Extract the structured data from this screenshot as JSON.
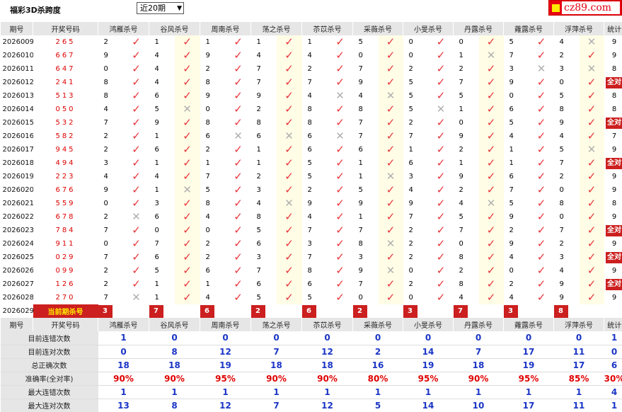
{
  "header": {
    "title": "福彩3D杀跨度",
    "period_select": "近20期",
    "logo_text": "cz89.com"
  },
  "columns": [
    "期号",
    "开奖号码",
    "鸿雁杀号",
    "谷风杀号",
    "周南杀号",
    "荡之杀号",
    "苶苡杀号",
    "采薇杀号",
    "小旻杀号",
    "丹露杀号",
    "蕹露杀号",
    "浮萍杀号",
    "统计"
  ],
  "rows": [
    {
      "period": "2026009",
      "number": "265",
      "kills": [
        [
          "2",
          1
        ],
        [
          "1",
          1
        ],
        [
          "1",
          1
        ],
        [
          "1",
          1
        ],
        [
          "1",
          1
        ],
        [
          "5",
          1
        ],
        [
          "0",
          1
        ],
        [
          "0",
          1
        ],
        [
          "5",
          1
        ],
        [
          "4",
          0
        ]
      ],
      "stat": "9"
    },
    {
      "period": "2026010",
      "number": "667",
      "kills": [
        [
          "9",
          1
        ],
        [
          "4",
          1
        ],
        [
          "9",
          1
        ],
        [
          "4",
          1
        ],
        [
          "4",
          1
        ],
        [
          "0",
          1
        ],
        [
          "0",
          1
        ],
        [
          "1",
          0
        ],
        [
          "7",
          1
        ],
        [
          "2",
          1
        ]
      ],
      "stat": "9"
    },
    {
      "period": "2026011",
      "number": "647",
      "kills": [
        [
          "0",
          1
        ],
        [
          "4",
          1
        ],
        [
          "2",
          1
        ],
        [
          "7",
          1
        ],
        [
          "2",
          1
        ],
        [
          "7",
          1
        ],
        [
          "2",
          1
        ],
        [
          "2",
          1
        ],
        [
          "3",
          0
        ],
        [
          "3",
          0
        ]
      ],
      "stat": "8"
    },
    {
      "period": "2026012",
      "number": "241",
      "kills": [
        [
          "8",
          1
        ],
        [
          "4",
          1
        ],
        [
          "8",
          1
        ],
        [
          "7",
          1
        ],
        [
          "7",
          1
        ],
        [
          "9",
          1
        ],
        [
          "5",
          1
        ],
        [
          "7",
          1
        ],
        [
          "9",
          1
        ],
        [
          "0",
          1
        ]
      ],
      "stat": "全对"
    },
    {
      "period": "2026013",
      "number": "513",
      "kills": [
        [
          "8",
          1
        ],
        [
          "6",
          1
        ],
        [
          "9",
          1
        ],
        [
          "9",
          1
        ],
        [
          "4",
          0
        ],
        [
          "4",
          0
        ],
        [
          "5",
          1
        ],
        [
          "5",
          1
        ],
        [
          "0",
          1
        ],
        [
          "5",
          1
        ]
      ],
      "stat": "8"
    },
    {
      "period": "2026014",
      "number": "050",
      "kills": [
        [
          "4",
          1
        ],
        [
          "5",
          0
        ],
        [
          "0",
          1
        ],
        [
          "2",
          1
        ],
        [
          "8",
          1
        ],
        [
          "8",
          1
        ],
        [
          "5",
          0
        ],
        [
          "1",
          1
        ],
        [
          "6",
          1
        ],
        [
          "8",
          1
        ]
      ],
      "stat": "8"
    },
    {
      "period": "2026015",
      "number": "532",
      "kills": [
        [
          "7",
          1
        ],
        [
          "9",
          1
        ],
        [
          "8",
          1
        ],
        [
          "8",
          1
        ],
        [
          "8",
          1
        ],
        [
          "7",
          1
        ],
        [
          "2",
          1
        ],
        [
          "0",
          1
        ],
        [
          "5",
          1
        ],
        [
          "9",
          1
        ]
      ],
      "stat": "全对"
    },
    {
      "period": "2026016",
      "number": "582",
      "kills": [
        [
          "2",
          1
        ],
        [
          "1",
          1
        ],
        [
          "6",
          0
        ],
        [
          "6",
          0
        ],
        [
          "6",
          0
        ],
        [
          "7",
          1
        ],
        [
          "7",
          1
        ],
        [
          "9",
          1
        ],
        [
          "4",
          1
        ],
        [
          "4",
          1
        ]
      ],
      "stat": "7"
    },
    {
      "period": "2026017",
      "number": "945",
      "kills": [
        [
          "2",
          1
        ],
        [
          "6",
          1
        ],
        [
          "2",
          1
        ],
        [
          "1",
          1
        ],
        [
          "6",
          1
        ],
        [
          "6",
          1
        ],
        [
          "1",
          1
        ],
        [
          "2",
          1
        ],
        [
          "1",
          1
        ],
        [
          "5",
          0
        ]
      ],
      "stat": "9"
    },
    {
      "period": "2026018",
      "number": "494",
      "kills": [
        [
          "3",
          1
        ],
        [
          "1",
          1
        ],
        [
          "1",
          1
        ],
        [
          "1",
          1
        ],
        [
          "5",
          1
        ],
        [
          "1",
          1
        ],
        [
          "6",
          1
        ],
        [
          "1",
          1
        ],
        [
          "1",
          1
        ],
        [
          "7",
          1
        ]
      ],
      "stat": "全对"
    },
    {
      "period": "2026019",
      "number": "223",
      "kills": [
        [
          "4",
          1
        ],
        [
          "4",
          1
        ],
        [
          "7",
          1
        ],
        [
          "2",
          1
        ],
        [
          "5",
          1
        ],
        [
          "1",
          0
        ],
        [
          "3",
          1
        ],
        [
          "9",
          1
        ],
        [
          "6",
          1
        ],
        [
          "2",
          1
        ]
      ],
      "stat": "9"
    },
    {
      "period": "2026020",
      "number": "676",
      "kills": [
        [
          "9",
          1
        ],
        [
          "1",
          0
        ],
        [
          "5",
          1
        ],
        [
          "3",
          1
        ],
        [
          "2",
          1
        ],
        [
          "5",
          1
        ],
        [
          "4",
          1
        ],
        [
          "2",
          1
        ],
        [
          "7",
          1
        ],
        [
          "0",
          1
        ]
      ],
      "stat": "9"
    },
    {
      "period": "2026021",
      "number": "559",
      "kills": [
        [
          "0",
          1
        ],
        [
          "3",
          1
        ],
        [
          "8",
          1
        ],
        [
          "4",
          0
        ],
        [
          "9",
          1
        ],
        [
          "9",
          1
        ],
        [
          "9",
          1
        ],
        [
          "4",
          0
        ],
        [
          "5",
          1
        ],
        [
          "8",
          1
        ]
      ],
      "stat": "8"
    },
    {
      "period": "2026022",
      "number": "678",
      "kills": [
        [
          "2",
          0
        ],
        [
          "6",
          1
        ],
        [
          "4",
          1
        ],
        [
          "8",
          1
        ],
        [
          "4",
          1
        ],
        [
          "1",
          1
        ],
        [
          "7",
          1
        ],
        [
          "5",
          1
        ],
        [
          "9",
          1
        ],
        [
          "0",
          1
        ]
      ],
      "stat": "9"
    },
    {
      "period": "2026023",
      "number": "784",
      "kills": [
        [
          "7",
          1
        ],
        [
          "0",
          1
        ],
        [
          "0",
          1
        ],
        [
          "5",
          1
        ],
        [
          "7",
          1
        ],
        [
          "7",
          1
        ],
        [
          "2",
          1
        ],
        [
          "7",
          1
        ],
        [
          "2",
          1
        ],
        [
          "7",
          1
        ]
      ],
      "stat": "全对"
    },
    {
      "period": "2026024",
      "number": "911",
      "kills": [
        [
          "0",
          1
        ],
        [
          "7",
          1
        ],
        [
          "2",
          1
        ],
        [
          "6",
          1
        ],
        [
          "3",
          1
        ],
        [
          "8",
          0
        ],
        [
          "2",
          1
        ],
        [
          "0",
          1
        ],
        [
          "9",
          1
        ],
        [
          "2",
          1
        ]
      ],
      "stat": "9"
    },
    {
      "period": "2026025",
      "number": "029",
      "kills": [
        [
          "7",
          1
        ],
        [
          "6",
          1
        ],
        [
          "2",
          1
        ],
        [
          "3",
          1
        ],
        [
          "7",
          1
        ],
        [
          "3",
          1
        ],
        [
          "2",
          1
        ],
        [
          "8",
          1
        ],
        [
          "4",
          1
        ],
        [
          "3",
          1
        ]
      ],
      "stat": "全对"
    },
    {
      "period": "2026026",
      "number": "099",
      "kills": [
        [
          "2",
          1
        ],
        [
          "5",
          1
        ],
        [
          "6",
          1
        ],
        [
          "7",
          1
        ],
        [
          "8",
          1
        ],
        [
          "9",
          0
        ],
        [
          "0",
          1
        ],
        [
          "2",
          1
        ],
        [
          "0",
          1
        ],
        [
          "4",
          1
        ]
      ],
      "stat": "9"
    },
    {
      "period": "2026027",
      "number": "126",
      "kills": [
        [
          "2",
          1
        ],
        [
          "1",
          1
        ],
        [
          "1",
          1
        ],
        [
          "6",
          1
        ],
        [
          "6",
          1
        ],
        [
          "7",
          1
        ],
        [
          "2",
          1
        ],
        [
          "8",
          1
        ],
        [
          "2",
          1
        ],
        [
          "9",
          1
        ]
      ],
      "stat": "全对"
    },
    {
      "period": "2026028",
      "number": "270",
      "kills": [
        [
          "7",
          0
        ],
        [
          "1",
          1
        ],
        [
          "4",
          1
        ],
        [
          "5",
          1
        ],
        [
          "5",
          1
        ],
        [
          "0",
          1
        ],
        [
          "0",
          1
        ],
        [
          "4",
          1
        ],
        [
          "4",
          1
        ],
        [
          "9",
          1
        ]
      ],
      "stat": "9"
    }
  ],
  "current": {
    "period": "2026029",
    "label": "当前期杀号",
    "kills": [
      "3",
      "7",
      "6",
      "2",
      "6",
      "2",
      "3",
      "7",
      "3",
      "8"
    ]
  },
  "summary": [
    {
      "label": "目前连错次数",
      "values": [
        "1",
        "0",
        "0",
        "0",
        "0",
        "0",
        "0",
        "0",
        "0",
        "0",
        "1"
      ],
      "red": false
    },
    {
      "label": "目前连对次数",
      "values": [
        "0",
        "8",
        "12",
        "7",
        "12",
        "2",
        "14",
        "7",
        "17",
        "11",
        "0"
      ],
      "red": false
    },
    {
      "label": "总正确次数",
      "values": [
        "18",
        "18",
        "19",
        "18",
        "18",
        "16",
        "19",
        "18",
        "19",
        "17",
        "6"
      ],
      "red": false
    },
    {
      "label": "准确率(全对率)",
      "values": [
        "90%",
        "90%",
        "95%",
        "90%",
        "90%",
        "80%",
        "95%",
        "90%",
        "95%",
        "85%",
        "30%"
      ],
      "red": true
    },
    {
      "label": "最大连错次数",
      "values": [
        "1",
        "1",
        "1",
        "1",
        "1",
        "1",
        "1",
        "1",
        "1",
        "1",
        "4"
      ],
      "red": false
    },
    {
      "label": "最大连对次数",
      "values": [
        "13",
        "8",
        "12",
        "7",
        "12",
        "5",
        "14",
        "10",
        "17",
        "11",
        "1"
      ],
      "red": false
    }
  ],
  "colors": {
    "tick": "#e8343a",
    "cross": "#b0b0b0",
    "badge": "#cc1f1f",
    "summary_blue": "#1a35c6",
    "summary_red": "#e00000"
  }
}
